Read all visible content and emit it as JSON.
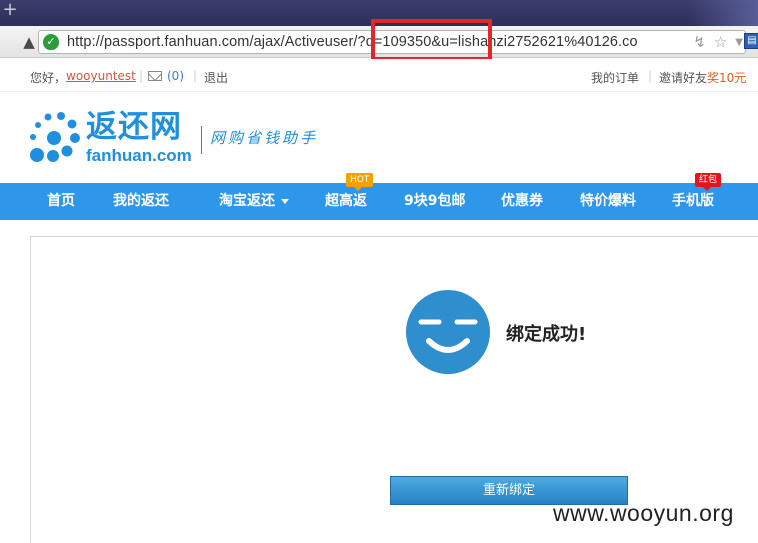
{
  "browser": {
    "new_tab_glyph": "+",
    "url": "http://passport.fanhuan.com/ajax/Activeuser/?d=109350&u=lishanzi2752621%40126.co",
    "icons": [
      "rocket-icon",
      "shield-icon",
      "lightning-icon",
      "star-icon",
      "dropdown-icon",
      "extension-icon"
    ]
  },
  "topbar": {
    "greeting": "您好，",
    "username": "wooyuntest",
    "mail_count": "(0)",
    "logout": "退出",
    "orders": "我的订单",
    "invite": "邀请好友",
    "reward": "奖10元"
  },
  "logo": {
    "name_cn": "返还网",
    "name_en": "fanhuan.com",
    "slogan": "网购省钱助手",
    "color": "#1f8fde"
  },
  "nav": {
    "items": [
      "首页",
      "我的返还",
      "淘宝返还",
      "超高返",
      "9块9包邮",
      "优惠券",
      "特价爆料",
      "手机版"
    ],
    "badge_hot": "HOT",
    "badge_red": "红包",
    "bg_color": "#2e97ea"
  },
  "main": {
    "status_text": "绑定成功!",
    "rebind_button": "重新绑定"
  },
  "watermark": "www.wooyun.org"
}
